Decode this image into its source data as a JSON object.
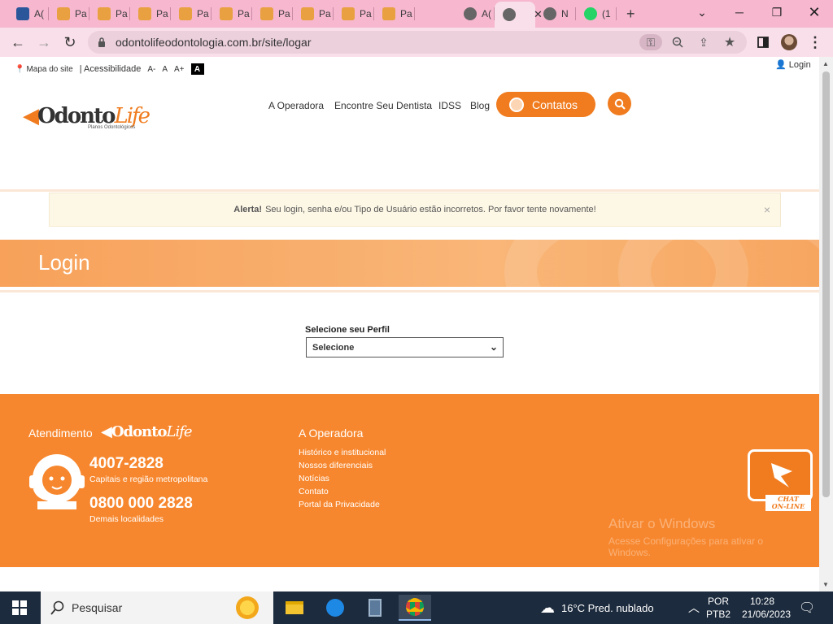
{
  "browser": {
    "tabs": [
      {
        "label": "A(",
        "favicon": "word-icon"
      },
      {
        "label": "Pa",
        "favicon": "stc-icon"
      },
      {
        "label": "Pa",
        "favicon": "stc-icon"
      },
      {
        "label": "Pa",
        "favicon": "stc-icon"
      },
      {
        "label": "Pa",
        "favicon": "stc-icon"
      },
      {
        "label": "Pa",
        "favicon": "stc-icon"
      },
      {
        "label": "Pa",
        "favicon": "stc-icon"
      },
      {
        "label": "Pa",
        "favicon": "stc-icon"
      },
      {
        "label": "Pa",
        "favicon": "stc-icon"
      },
      {
        "label": "Pa",
        "favicon": "stc-icon"
      },
      {
        "label": "A(",
        "favicon": "globe-icon"
      },
      {
        "label": "",
        "favicon": "globe-icon",
        "active": true
      },
      {
        "label": "N",
        "favicon": "globe-icon"
      },
      {
        "label": "(1",
        "favicon": "whatsapp-icon"
      }
    ],
    "new_tab": "+",
    "url": "odontolifeodontologia.com.br/site/logar",
    "colors": {
      "tabstrip": "#f6b7cf",
      "toolbar": "#f9dfe9"
    }
  },
  "site": {
    "topbar": {
      "sitemap": "Mapa do site",
      "accessibility": "| Acessibilidade",
      "font_minus": "A-",
      "font_normal": "A",
      "font_plus": "A+",
      "contrast": "A",
      "login": "Login"
    },
    "logo": {
      "brand_a": "Odonto",
      "brand_b": "Life",
      "tagline": "Planos Odontológicos"
    },
    "nav": {
      "operadora": "A Operadora",
      "dentista": "Encontre Seu Dentista",
      "idss": "IDSS",
      "blog": "Blog",
      "contatos": "Contatos"
    },
    "alert": {
      "strong": "Alerta!",
      "message": "Seu login, senha e/ou Tipo de Usuário estão incorretos. Por favor tente novamente!",
      "close": "×"
    },
    "banner_title": "Login",
    "profile": {
      "label": "Selecione seu Perfil",
      "selected": "Selecione"
    },
    "footer": {
      "atendimento": "Atendimento",
      "phone1": "4007-2828",
      "phone1_note": "Capitais e região metropolitana",
      "phone2": "0800 000 2828",
      "phone2_note": "Demais localidades",
      "operadora_title": "A Operadora",
      "links": [
        "Histórico e institucional",
        "Nossos diferenciais",
        "Notícias",
        "Contato",
        "Portal da Privacidade"
      ],
      "chat_line1": "CHAT",
      "chat_line2": "ON-LINE",
      "watermark_title": "Ativar o Windows",
      "watermark_text": "Acesse Configurações para ativar o Windows."
    },
    "colors": {
      "brand_orange": "#f07c1f",
      "footer": "#f7872e",
      "alert_bg": "#fdf7e5"
    }
  },
  "taskbar": {
    "search_placeholder": "Pesquisar",
    "weather": "16°C  Pred. nublado",
    "lang_line1": "POR",
    "lang_line2": "PTB2",
    "time": "10:28",
    "date": "21/06/2023"
  }
}
